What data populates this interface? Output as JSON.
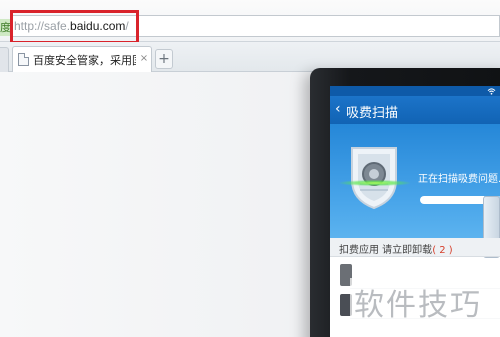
{
  "browser": {
    "address_bar": {
      "prefix": "度",
      "url_scheme": "http://safe.",
      "url_host": "baidu.com",
      "url_path": "/"
    },
    "tabs": [
      {
        "title": "百度安全管家，采用国际领",
        "close": "×"
      }
    ],
    "new_tab_label": "+"
  },
  "phone_app": {
    "title": "吸费扫描",
    "back_glyph": "‹",
    "scan_status": "正在扫描吸费问题...",
    "scan_progress": 0.8,
    "section_label": "扣费应用 请立即卸载",
    "section_count": "( 2 )"
  },
  "watermark": "软件技巧",
  "colors": {
    "highlight_box": "#d9232b",
    "app_blue": "#1c74c9",
    "accent_red": "#d6402c"
  },
  "icons": [
    "page-icon",
    "close-icon",
    "plus-icon",
    "wifi-icon",
    "back-icon",
    "shield-icon"
  ]
}
